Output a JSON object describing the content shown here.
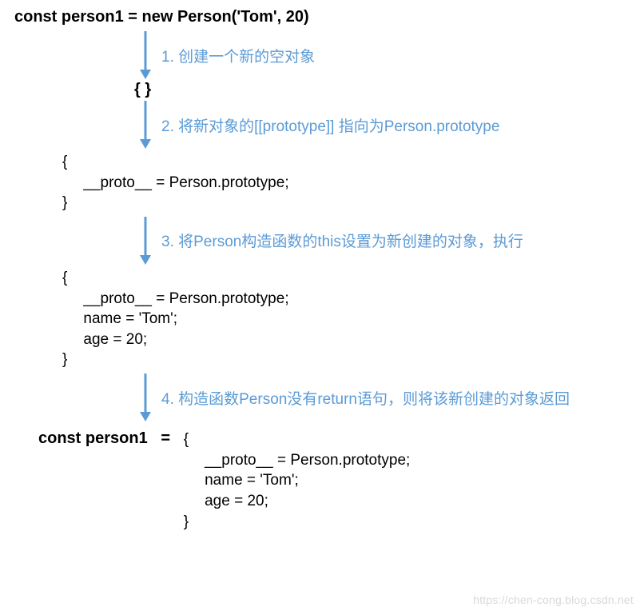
{
  "title": "const person1 = new Person('Tom', 20)",
  "steps": {
    "s1": "1. 创建一个新的空对象",
    "s2": "2. 将新对象的[[prototype]] 指向为Person.prototype",
    "s3": "3. 将Person构造函数的this设置为新创建的对象，执行",
    "s4": "4. 构造函数Person没有return语句，则将该新创建的对象返回"
  },
  "blocks": {
    "empty": "{ }",
    "b2": "{\n     __proto__ = Person.prototype;\n}",
    "b3": "{\n     __proto__ = Person.prototype;\n     name = 'Tom';\n     age = 20;\n}",
    "final_label": "const person1   =   ",
    "final_code": "{\n     __proto__ = Person.prototype;\n     name = 'Tom';\n     age = 20;\n}"
  },
  "colors": {
    "arrow": "#5b9bd5"
  },
  "watermark": "https://chen-cong.blog.csdn.net"
}
